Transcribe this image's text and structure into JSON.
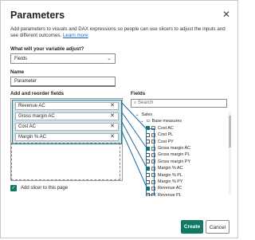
{
  "dialog": {
    "title": "Parameters",
    "description": "Add parameters to visuals and DAX expressions so people can use slicers to adjust the inputs and see different outcomes.",
    "learn_more": "Learn more",
    "close_icon": "close-icon"
  },
  "variable": {
    "label": "What will your variable adjust?",
    "value": "Fields"
  },
  "name": {
    "label": "Name",
    "value": "Parameter"
  },
  "add_fields": {
    "label": "Add and reorder fields",
    "chips": [
      "Revenue AC",
      "Gross margin AC",
      "Cost AC",
      "Margin % AC"
    ]
  },
  "slicer": {
    "label": "Add slicer to this page",
    "checked": true
  },
  "fields": {
    "label": "Fields",
    "search_placeholder": "Search",
    "tree": [
      {
        "text": "Sales",
        "level": 0,
        "type": "table"
      },
      {
        "text": "Base measures",
        "level": 1,
        "type": "folder"
      },
      {
        "text": "Cost AC",
        "level": 2,
        "checked": true
      },
      {
        "text": "Cost PL",
        "level": 2,
        "checked": false
      },
      {
        "text": "Cost PY",
        "level": 2,
        "checked": false
      },
      {
        "text": "Gross margin AC",
        "level": 2,
        "checked": true
      },
      {
        "text": "Gross margin PL",
        "level": 2,
        "checked": false
      },
      {
        "text": "Gross margin PY",
        "level": 2,
        "checked": false
      },
      {
        "text": "Margin % AC",
        "level": 2,
        "checked": true
      },
      {
        "text": "Margin % PL",
        "level": 2,
        "checked": false
      },
      {
        "text": "Margin % PY",
        "level": 2,
        "checked": false
      },
      {
        "text": "Revenue AC",
        "level": 2,
        "checked": true
      },
      {
        "text": "Revenue PL",
        "level": 2,
        "checked": false
      }
    ]
  },
  "buttons": {
    "create": "Create",
    "cancel": "Cancel"
  },
  "colors": {
    "accent": "#117865",
    "highlight_border": "#1e8093",
    "highlight_fill": "#cbe3ed"
  }
}
